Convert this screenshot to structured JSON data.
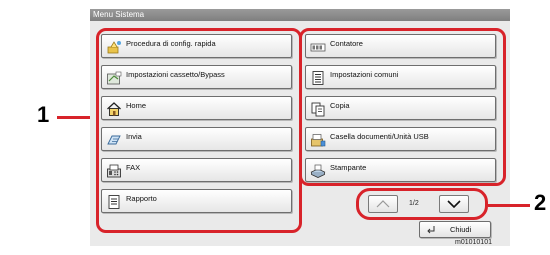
{
  "window": {
    "title": "Menu Sistema"
  },
  "menu_items": [
    {
      "label": "Procedura di config. rapida",
      "icon": "wizard-icon"
    },
    {
      "label": "Contatore",
      "icon": "counter-icon"
    },
    {
      "label": "Impostazioni cassetto/Bypass",
      "icon": "cassette-icon"
    },
    {
      "label": "Impostazioni comuni",
      "icon": "document-list-icon"
    },
    {
      "label": "Home",
      "icon": "home-icon"
    },
    {
      "label": "Copia",
      "icon": "copy-icon"
    },
    {
      "label": "Invia",
      "icon": "send-icon"
    },
    {
      "label": "Casella documenti/Unità USB",
      "icon": "document-box-icon"
    },
    {
      "label": "FAX",
      "icon": "fax-icon"
    },
    {
      "label": "Stampante",
      "icon": "printer-icon"
    },
    {
      "label": "Rapporto",
      "icon": "report-icon"
    }
  ],
  "pagination": {
    "indicator": "1/2"
  },
  "close_button": {
    "label": "Chiudi"
  },
  "callouts": {
    "one": "1",
    "two": "2"
  },
  "image_code": "m01010101",
  "colors": {
    "callout_red": "#d8232a",
    "title_bar": "#8a8a8a",
    "panel_bg": "#eaeaea"
  }
}
